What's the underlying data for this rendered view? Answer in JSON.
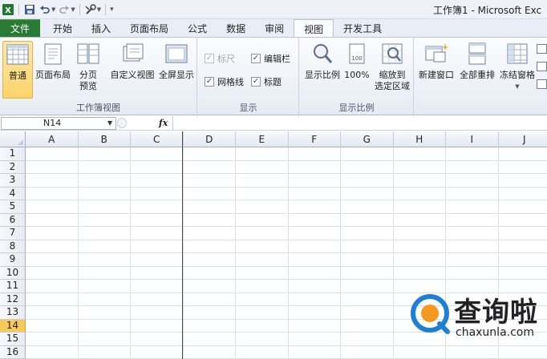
{
  "window": {
    "title": "工作簿1 - Microsoft Exc"
  },
  "qat": {
    "icons": [
      "excel-icon",
      "save-icon",
      "undo-icon",
      "redo-icon",
      "tool-icon",
      "customize-qat-icon"
    ]
  },
  "tabs": [
    {
      "label": "文件",
      "kind": "file"
    },
    {
      "label": "开始"
    },
    {
      "label": "插入"
    },
    {
      "label": "页面布局"
    },
    {
      "label": "公式"
    },
    {
      "label": "数据"
    },
    {
      "label": "审阅"
    },
    {
      "label": "视图",
      "active": true
    },
    {
      "label": "开发工具"
    }
  ],
  "ribbon": {
    "workbook_views": {
      "label": "工作簿视图",
      "normal": "普通",
      "page_layout": "页面布局",
      "page_break_1": "分页",
      "page_break_2": "预览",
      "custom_views": "自定义视图",
      "full_screen": "全屏显示"
    },
    "show": {
      "label": "显示",
      "ruler": "标尺",
      "formula_bar": "编辑栏",
      "gridlines": "网格线",
      "headings": "标题"
    },
    "zoom": {
      "label": "显示比例",
      "zoom": "显示比例",
      "zoom_100": "100%",
      "zoom_selection_1": "缩放到",
      "zoom_selection_2": "选定区域"
    },
    "window": {
      "new_window": "新建窗口",
      "arrange_all": "全部重排",
      "freeze_panes": "冻结窗格"
    },
    "accent": "#2a7a35"
  },
  "formula_bar": {
    "name_box": "N14",
    "fx": "fx",
    "value": ""
  },
  "sheet": {
    "columns": [
      "A",
      "B",
      "C",
      "D",
      "E",
      "F",
      "G",
      "H",
      "I",
      "J"
    ],
    "rows": [
      "1",
      "2",
      "3",
      "4",
      "5",
      "6",
      "7",
      "8",
      "9",
      "10",
      "11",
      "12",
      "13",
      "14",
      "15",
      "16"
    ],
    "selected_row": "14"
  },
  "watermark": {
    "text": "查询啦",
    "sub": "chaxunla.com"
  }
}
